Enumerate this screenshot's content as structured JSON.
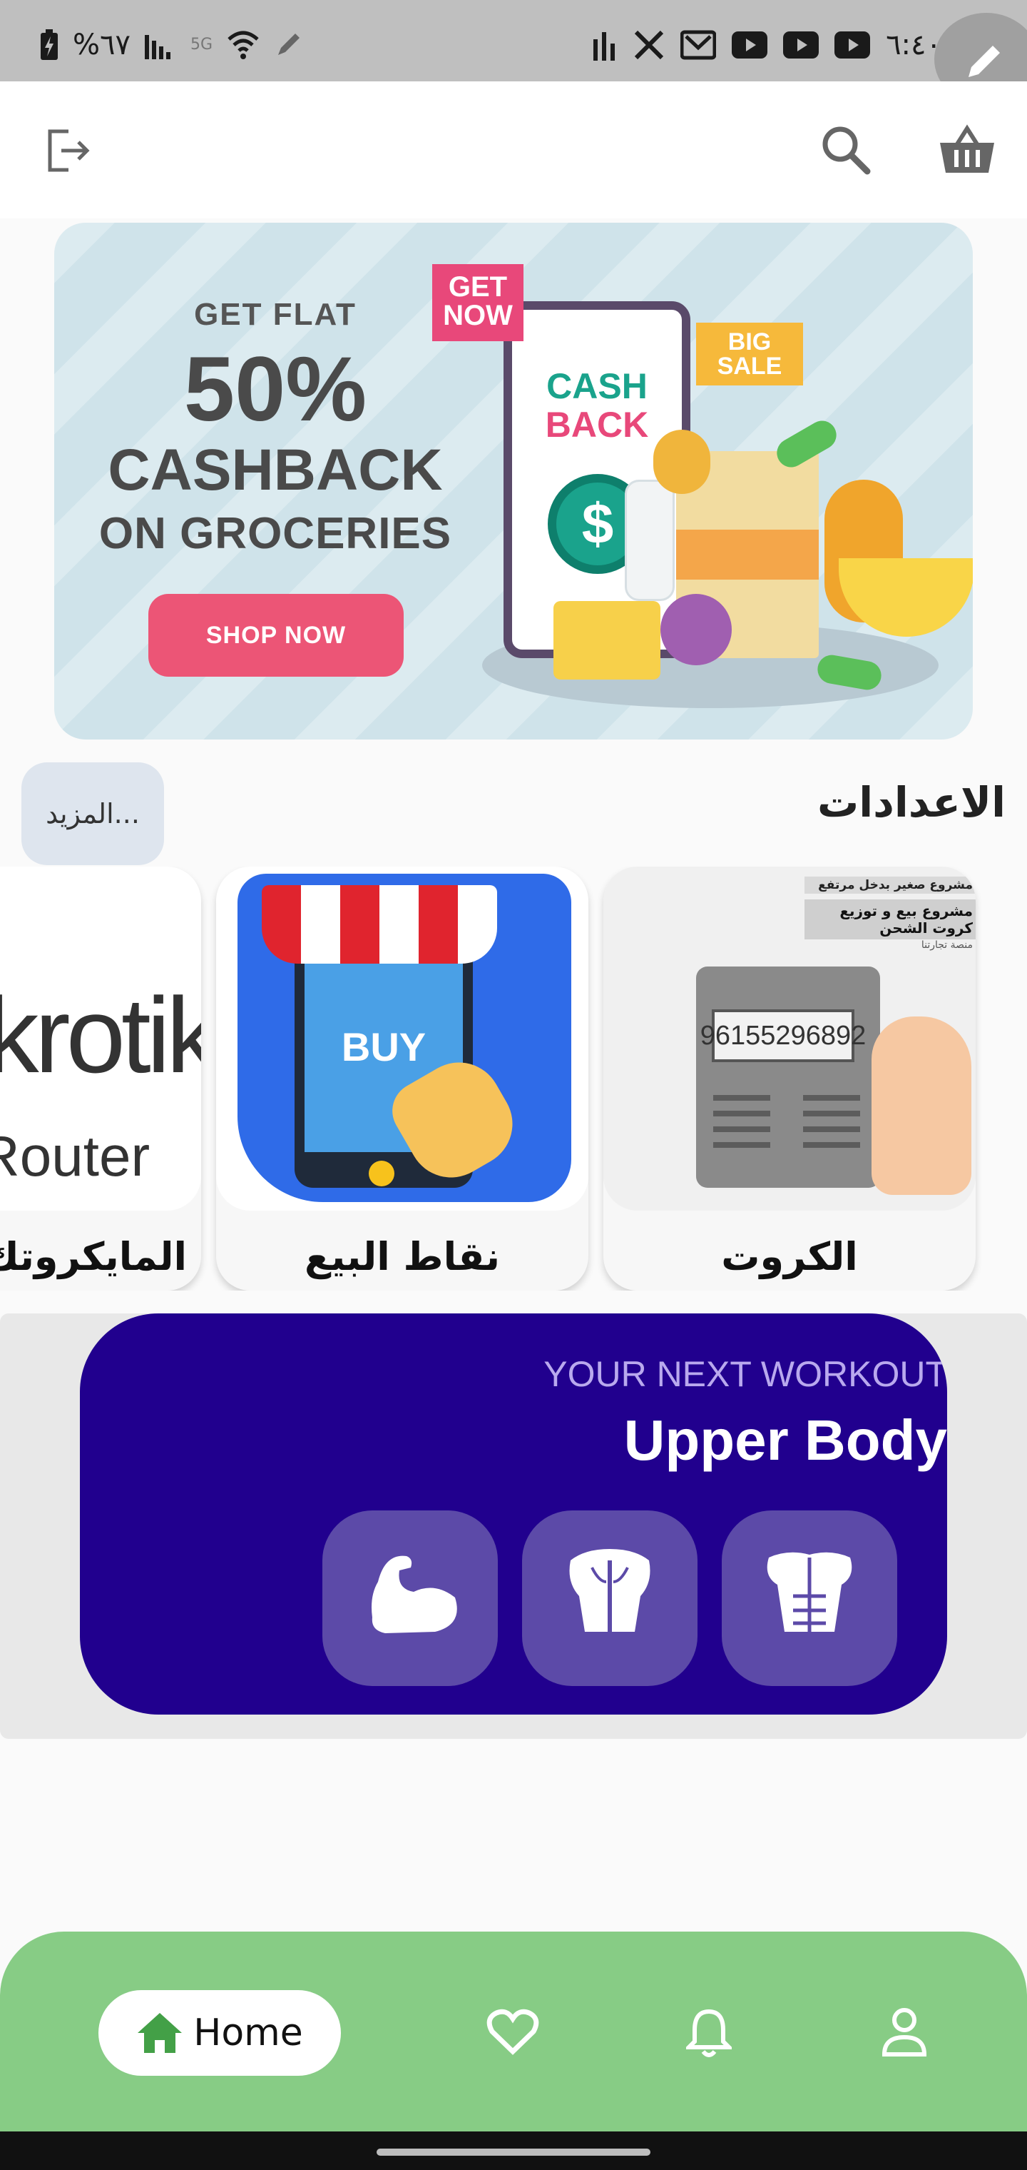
{
  "status_bar": {
    "battery": "%٦٧",
    "network_type": "5G",
    "time": "٦:٤٠",
    "icons": [
      "battery-charging-icon",
      "signal-icon",
      "wifi-icon",
      "pen-icon",
      "bars-icon",
      "x-icon",
      "mail-icon",
      "youtube-icon",
      "youtube-icon",
      "youtube-icon"
    ]
  },
  "app_bar": {
    "icons": [
      "logout-icon",
      "search-icon",
      "basket-icon"
    ]
  },
  "banner": {
    "line1": "GET FLAT",
    "line2": "50%",
    "line3": "CASHBACK",
    "line4": "ON GROCERIES",
    "cta": "SHOP NOW",
    "tag_get_now": "GET NOW",
    "tag_big_sale": "BIG SALE",
    "cash": "CASH",
    "back": "BACK",
    "dollar": "$"
  },
  "settings_section": {
    "title": "الاعدادات",
    "more_label": "المزيد..."
  },
  "categories": [
    {
      "label": "الكروت",
      "image_lines": [
        "مشروع صغير بدخل مرتفع",
        "مشروع بيع و توزيع كروت الشحن",
        "منصة تجارتنا"
      ],
      "card_number": "96155296892"
    },
    {
      "label": "نقاط البيع",
      "image_text": "BUY"
    },
    {
      "label": "المايكروتك",
      "image_text": "Mikrotik",
      "image_sub": "Router"
    }
  ],
  "workout": {
    "subtitle": "YOUR NEXT WORKOUT",
    "title": "Upper Body",
    "muscles": [
      {
        "icon": "biceps-icon"
      },
      {
        "icon": "back-muscles-icon"
      },
      {
        "icon": "chest-abs-icon"
      }
    ]
  },
  "bottom_nav": {
    "home_label": "Home",
    "items": [
      "home-icon",
      "heart-icon",
      "bell-icon",
      "person-icon"
    ]
  },
  "colors": {
    "workout_bg": "#21008e",
    "nav_bg": "#87cc85",
    "home_icon": "#43a047",
    "banner_cta": "#ec5576"
  }
}
